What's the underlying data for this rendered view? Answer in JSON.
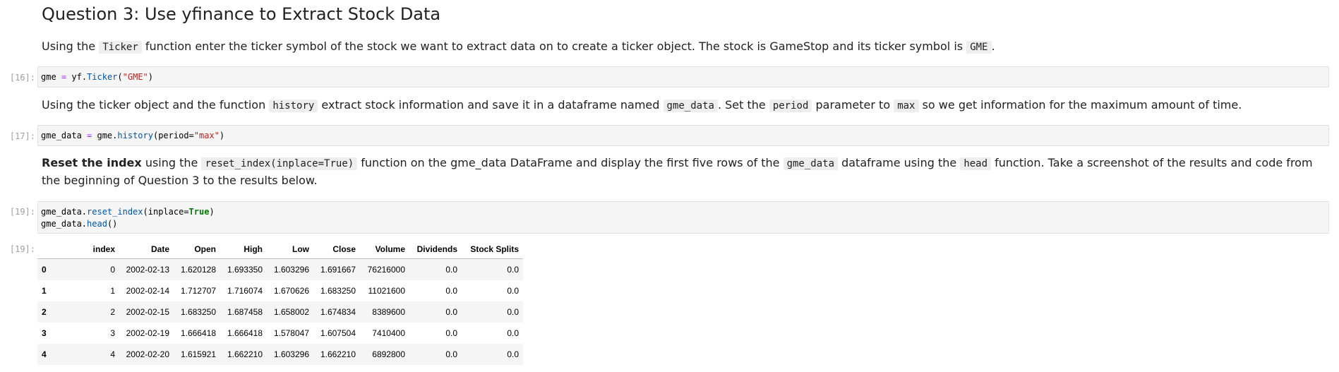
{
  "heading": "Question 3: Use yfinance to Extract Stock Data",
  "md1": {
    "t1": "Using the ",
    "c1": "Ticker",
    "t2": " function enter the ticker symbol of the stock we want to extract data on to create a ticker object. The stock is GameStop and its ticker symbol is ",
    "c2": "GME",
    "t3": "."
  },
  "cell16": {
    "prompt": "[16]:",
    "tokens": [
      "gme",
      " = ",
      "yf.",
      "Ticker",
      "(",
      "\"GME\"",
      ")"
    ]
  },
  "md2": {
    "t1": "Using the ticker object and the function ",
    "c1": "history",
    "t2": " extract stock information and save it in a dataframe named ",
    "c2": "gme_data",
    "t3": ". Set the ",
    "c3": "period",
    "t4": " parameter to ",
    "c4": "max",
    "t5": " so we get information for the maximum amount of time."
  },
  "cell17": {
    "prompt": "[17]:",
    "tokens": [
      "gme_data",
      " = ",
      "gme.",
      "history",
      "(period=",
      "\"max\"",
      ")"
    ]
  },
  "md3": {
    "bold": "Reset the index",
    "t1": " using the ",
    "c1": "reset_index(inplace=True)",
    "t2": " function on the gme_data DataFrame and display the first five rows of the ",
    "c2": "gme_data",
    "t3": " dataframe using the ",
    "c3": "head",
    "t4": " function. Take a screenshot of the results and code from the beginning of Question 3 to the results below."
  },
  "cell19": {
    "prompt": "[19]:",
    "line1": [
      "gme_data.",
      "reset_index",
      "(inplace=",
      "True",
      ")"
    ],
    "line2": [
      "gme_data.",
      "head",
      "()"
    ]
  },
  "output19": {
    "prompt": "[19]:",
    "columns": [
      "",
      "index",
      "Date",
      "Open",
      "High",
      "Low",
      "Close",
      "Volume",
      "Dividends",
      "Stock Splits"
    ],
    "rows": [
      [
        "0",
        "0",
        "2002-02-13",
        "1.620128",
        "1.693350",
        "1.603296",
        "1.691667",
        "76216000",
        "0.0",
        "0.0"
      ],
      [
        "1",
        "1",
        "2002-02-14",
        "1.712707",
        "1.716074",
        "1.670626",
        "1.683250",
        "11021600",
        "0.0",
        "0.0"
      ],
      [
        "2",
        "2",
        "2002-02-15",
        "1.683250",
        "1.687458",
        "1.658002",
        "1.674834",
        "8389600",
        "0.0",
        "0.0"
      ],
      [
        "3",
        "3",
        "2002-02-19",
        "1.666418",
        "1.666418",
        "1.578047",
        "1.607504",
        "7410400",
        "0.0",
        "0.0"
      ],
      [
        "4",
        "4",
        "2002-02-20",
        "1.615921",
        "1.662210",
        "1.603296",
        "1.662210",
        "6892800",
        "0.0",
        "0.0"
      ]
    ]
  }
}
